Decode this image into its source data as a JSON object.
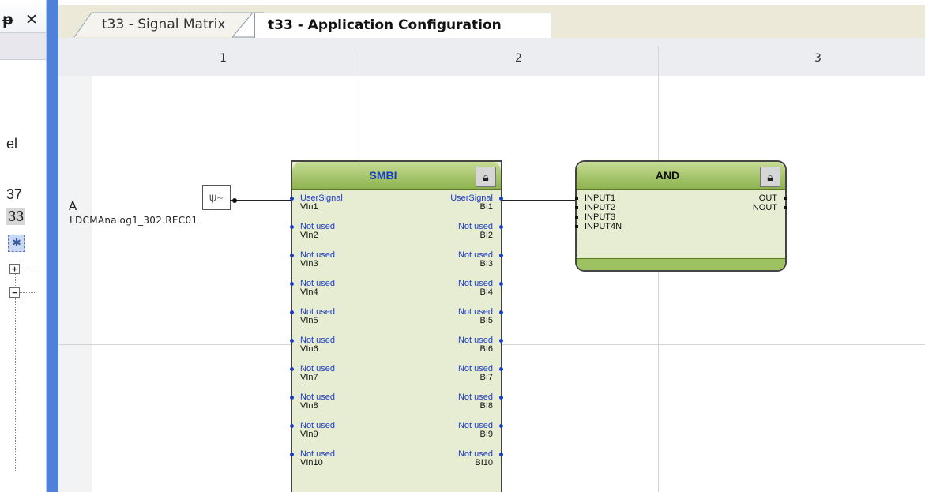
{
  "left_panel": {
    "pin_icon": "ᵽ",
    "close_icon": "✕",
    "texts": [
      "el",
      "37",
      "33"
    ]
  },
  "tabs": [
    {
      "label": "t33 - Signal Matrix",
      "active": false
    },
    {
      "label": "t33 - Application Configuration",
      "active": true
    }
  ],
  "grid": {
    "columns": [
      "1",
      "2",
      "3"
    ],
    "rows": [
      "A"
    ]
  },
  "signal": {
    "name": "LDCMAnalog1_302.REC01",
    "icon": "signal-input-icon"
  },
  "smbi": {
    "title": "SMBI",
    "inputs": [
      {
        "label": "UserSignal",
        "name": "VIn1"
      },
      {
        "label": "Not used",
        "name": "VIn2"
      },
      {
        "label": "Not used",
        "name": "VIn3"
      },
      {
        "label": "Not used",
        "name": "VIn4"
      },
      {
        "label": "Not used",
        "name": "VIn5"
      },
      {
        "label": "Not used",
        "name": "VIn6"
      },
      {
        "label": "Not used",
        "name": "VIn7"
      },
      {
        "label": "Not used",
        "name": "VIn8"
      },
      {
        "label": "Not used",
        "name": "VIn9"
      },
      {
        "label": "Not used",
        "name": "VIn10"
      }
    ],
    "outputs": [
      {
        "label": "UserSignal",
        "name": "BI1"
      },
      {
        "label": "Not used",
        "name": "BI2"
      },
      {
        "label": "Not used",
        "name": "BI3"
      },
      {
        "label": "Not used",
        "name": "BI4"
      },
      {
        "label": "Not used",
        "name": "BI5"
      },
      {
        "label": "Not used",
        "name": "BI6"
      },
      {
        "label": "Not used",
        "name": "BI7"
      },
      {
        "label": "Not used",
        "name": "BI8"
      },
      {
        "label": "Not used",
        "name": "BI9"
      },
      {
        "label": "Not used",
        "name": "BI10"
      }
    ]
  },
  "and_block": {
    "title": "AND",
    "inputs": [
      "INPUT1",
      "INPUT2",
      "INPUT3",
      "INPUT4N"
    ],
    "outputs": [
      "OUT",
      "NOUT"
    ]
  },
  "colors": {
    "splitter": "#4d82d8",
    "block_header": "#8db24e",
    "block_body": "#e6edd3",
    "port_blue": "#1b3cc9"
  }
}
